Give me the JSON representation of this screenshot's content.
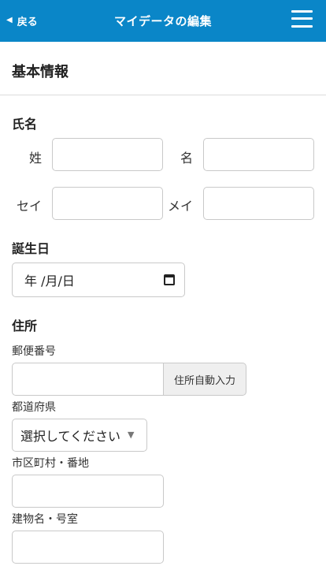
{
  "header": {
    "back_label": "戻る",
    "title": "マイデータの編集",
    "bg_color": "#0a86c8"
  },
  "section": {
    "title": "基本情報"
  },
  "name": {
    "group_label": "氏名",
    "last_label": "姓",
    "first_label": "名",
    "last_kana_label": "セイ",
    "first_kana_label": "メイ",
    "last_value": "",
    "first_value": "",
    "last_kana_value": "",
    "first_kana_value": ""
  },
  "birthday": {
    "group_label": "誕生日",
    "placeholder": "年 /月/日"
  },
  "address": {
    "group_label": "住所",
    "zip_label": "郵便番号",
    "zip_value": "",
    "auto_fill_button": "住所自動入力",
    "prefecture_label": "都道府県",
    "prefecture_selected": "選択してください",
    "city_label": "市区町村・番地",
    "city_value": "",
    "building_label": "建物名・号室",
    "building_value": ""
  },
  "icons": [
    "back-triangle-icon",
    "hamburger-menu-icon",
    "calendar-icon",
    "dropdown-caret-icon"
  ]
}
